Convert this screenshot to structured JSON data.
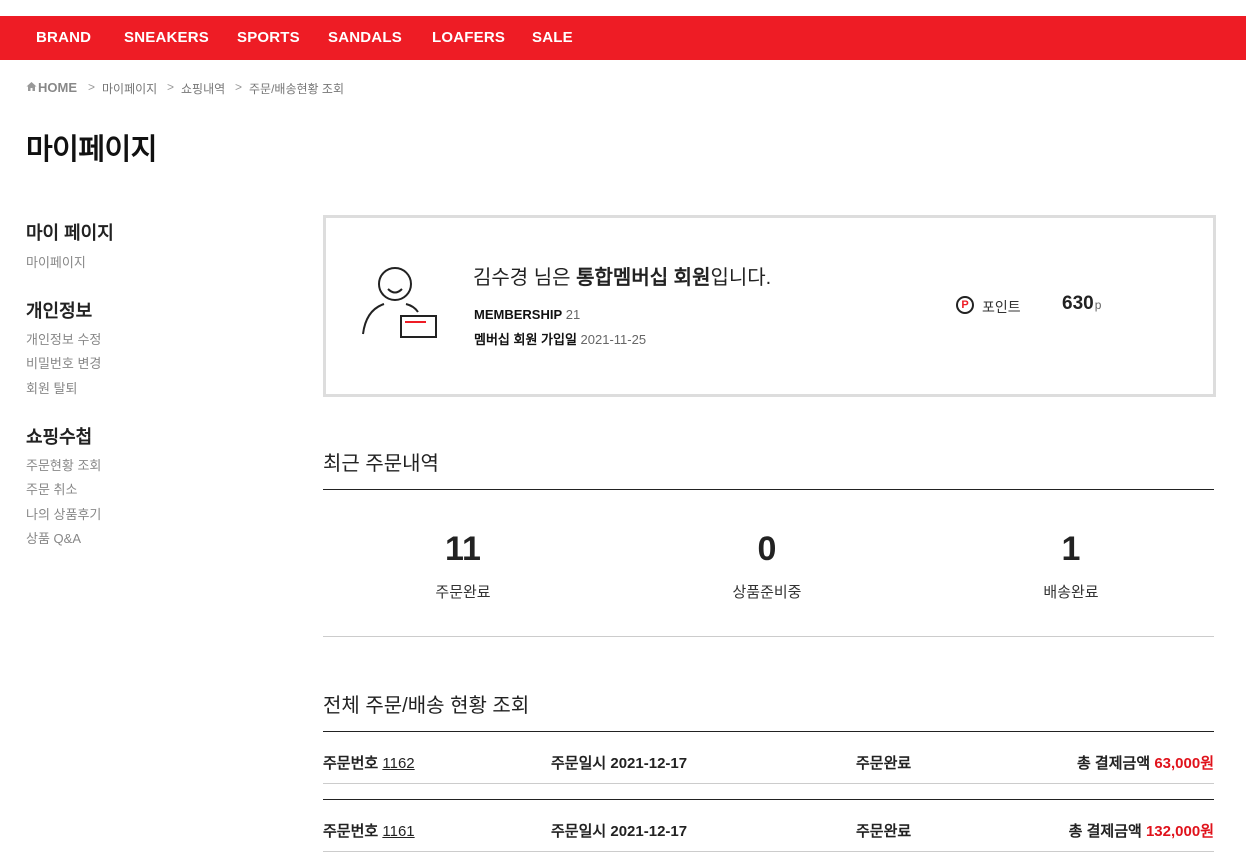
{
  "nav": [
    "BRAND",
    "SNEAKERS",
    "SPORTS",
    "SANDALS",
    "LOAFERS",
    "SALE"
  ],
  "breadcrumb": {
    "home": "HOME",
    "items": [
      "마이페이지",
      "쇼핑내역",
      "주문/배송현황 조회"
    ],
    "separator": ">"
  },
  "page_title": "마이페이지",
  "sidebar": {
    "groups": [
      {
        "title": "마이 페이지",
        "items": [
          "마이페이지"
        ]
      },
      {
        "title": "개인정보",
        "items": [
          "개인정보 수정",
          "비밀번호 변경",
          "회원 탈퇴"
        ]
      },
      {
        "title": "쇼핑수첩",
        "items": [
          "주문현황 조회",
          "주문 취소",
          "나의 상품후기",
          "상품 Q&A"
        ]
      }
    ]
  },
  "member": {
    "name_prefix": "김수경 님은 ",
    "grade": "통합멤버십 회원",
    "name_suffix": "입니다.",
    "membership_label": "MEMBERSHIP",
    "membership_value": "21",
    "join_label": "멤버십 회원 가입일",
    "join_date": "2021-11-25",
    "point_icon": "P",
    "point_label": "포인트",
    "point_value": "630",
    "point_unit": "p"
  },
  "recent": {
    "title": "최근 주문내역",
    "stats": [
      {
        "value": "11",
        "label": "주문완료"
      },
      {
        "value": "0",
        "label": "상품준비중"
      },
      {
        "value": "1",
        "label": "배송완료"
      }
    ]
  },
  "orders": {
    "title": "전체 주문/배송 현황 조회",
    "order_no_label": "주문번호",
    "date_label": "주문일시",
    "total_label": "총 결제금액",
    "rows": [
      {
        "no": "1162",
        "date": "2021-12-17",
        "status": "주문완료",
        "amount": "63,000원"
      },
      {
        "no": "1161",
        "date": "2021-12-17",
        "status": "주문완료",
        "amount": "132,000원"
      }
    ]
  },
  "colors": {
    "brand_red": "#ee1c25",
    "amount_red": "#e0121b"
  }
}
